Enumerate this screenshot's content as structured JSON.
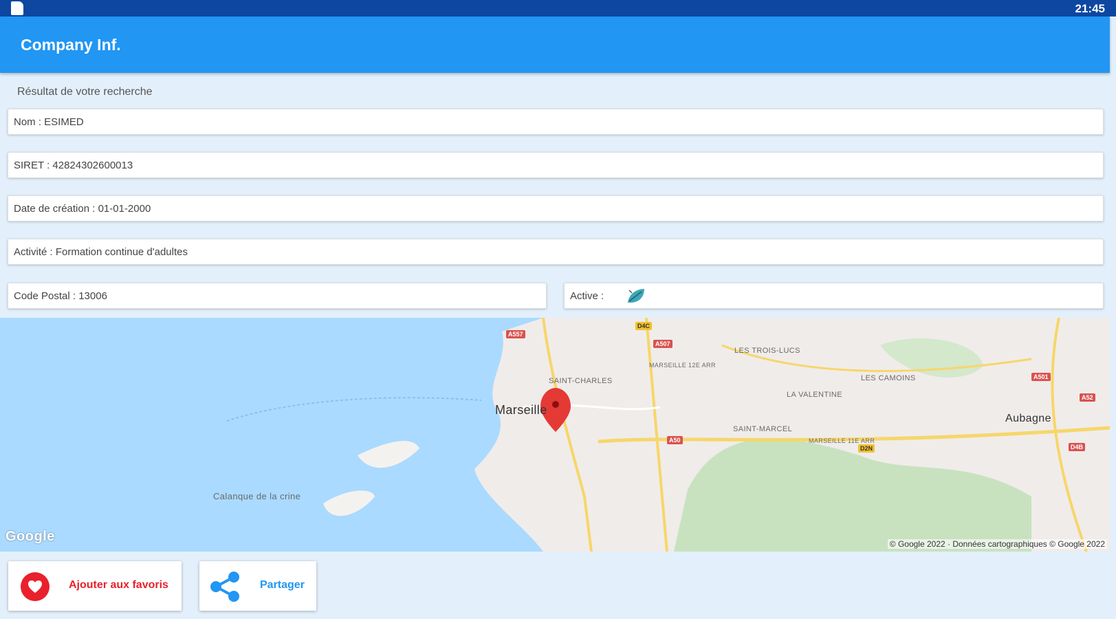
{
  "status_bar": {
    "time": "21:45"
  },
  "app_bar": {
    "title": "Company Inf."
  },
  "subtitle": "Résultat de votre recherche",
  "fields": {
    "nom": "Nom : ESIMED",
    "siret": "SIRET : 42824302600013",
    "date_creation": "Date de création : 01-01-2000",
    "activite": "Activité : Formation continue d'adultes",
    "code_postal": "Code Postal : 13006",
    "active_label": "Active :"
  },
  "map": {
    "city": "Marseille",
    "places": [
      "LES TROIS-LUCS",
      "SAINT-CHARLES",
      "LES CAMOINS",
      "LA VALENTINE",
      "SAINT-MARCEL",
      "Aubagne",
      "Calanque de la crine",
      "MARSEILLE 12E ARR",
      "MARSEILLE 11E ARR"
    ],
    "roads": [
      "A557",
      "A507",
      "D4C",
      "A50",
      "A501",
      "A52",
      "D2N",
      "D4B"
    ],
    "logo": "Google",
    "copyright": "© Google 2022 · Données cartographiques © Google 2022"
  },
  "actions": {
    "favorite": "Ajouter aux favoris",
    "share": "Partager"
  },
  "colors": {
    "status_bar": "#0d47a1",
    "app_bar": "#2196f3",
    "background": "#e3f0fb",
    "favorite": "#e8212c",
    "share": "#2196f3",
    "pin": "#e53935"
  }
}
